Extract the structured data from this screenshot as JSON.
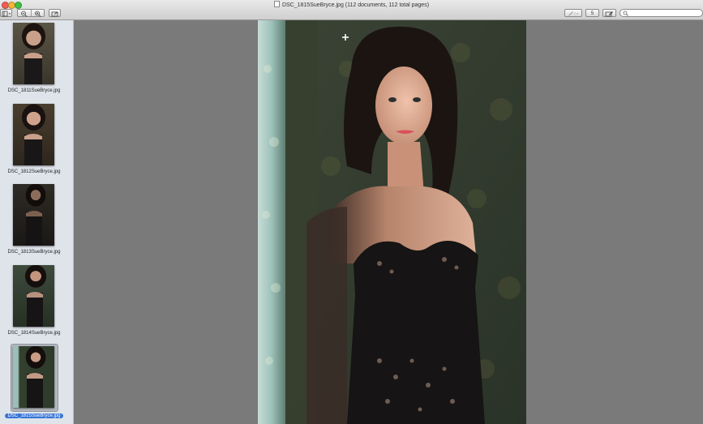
{
  "window": {
    "title": "DSC_1815SueBryce.jpg (112 documents, 112 total pages)"
  },
  "toolbar": {
    "view_button_icon": "sidebar-view-icon",
    "zoom_out_icon": "zoom-out-icon",
    "zoom_in_icon": "zoom-in-icon",
    "share_icon": "share-icon",
    "annotate_icon": "pen-icon",
    "page_number": "5",
    "edit_icon": "edit-toolbar-icon",
    "search_placeholder": ""
  },
  "sidebar": {
    "items": [
      {
        "label": "DSC_1811SueBryce.jpg",
        "selected": false
      },
      {
        "label": "DSC_1812SueBryce.jpg",
        "selected": false
      },
      {
        "label": "DSC_1813SueBryce.jpg",
        "selected": false
      },
      {
        "label": "DSC_1814SueBryce.jpg",
        "selected": false
      },
      {
        "label": "DSC_1815SueBryce.jpg",
        "selected": true
      }
    ]
  },
  "colors": {
    "background": "#7a7a7a",
    "sidebar": "#dfe4ea",
    "selection": "#3875d7"
  }
}
